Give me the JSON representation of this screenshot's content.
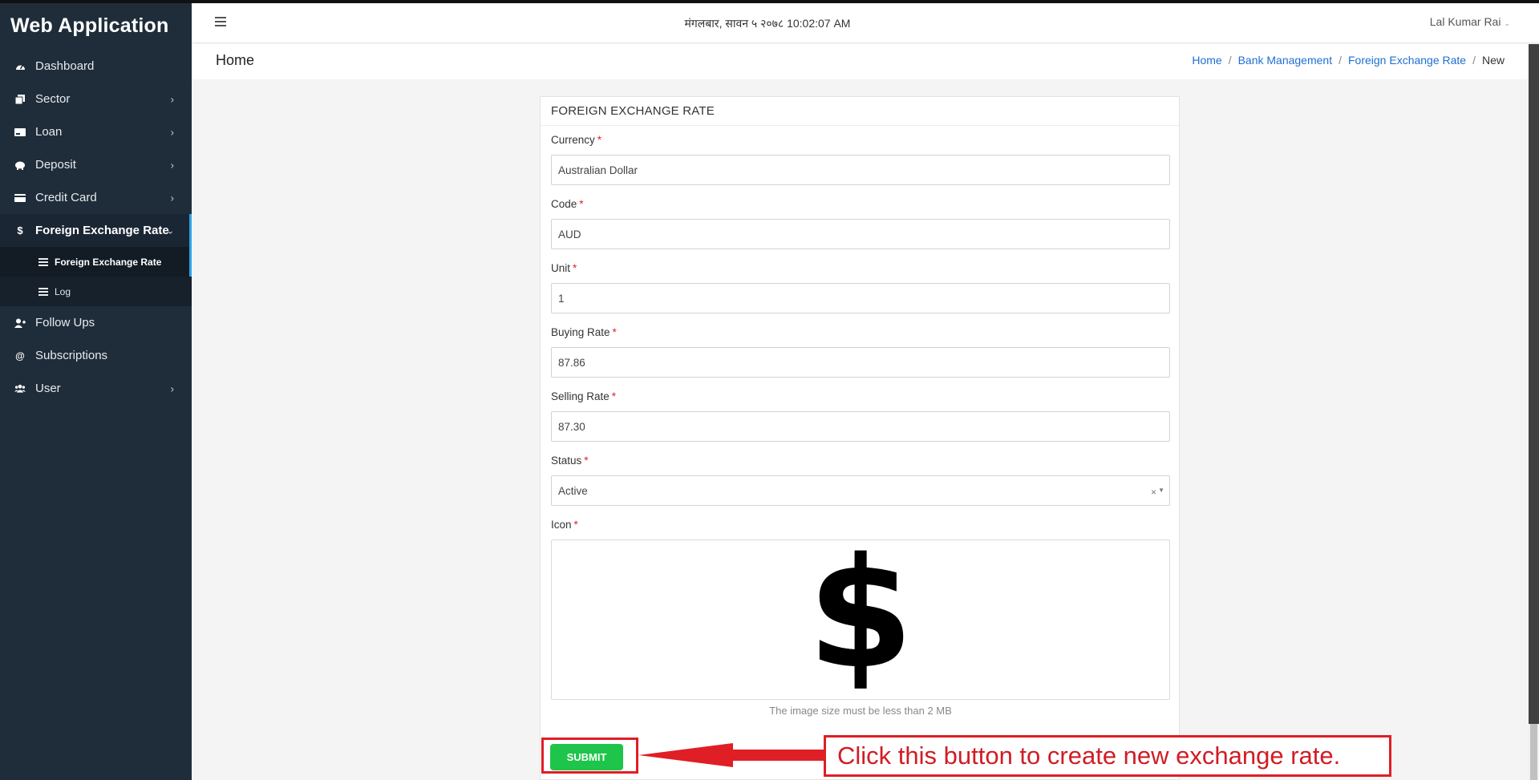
{
  "app": {
    "title": "Web Application"
  },
  "sidebar": {
    "items": [
      {
        "label": "Dashboard",
        "icon": "dashboard-icon"
      },
      {
        "label": "Sector",
        "icon": "sector-icon"
      },
      {
        "label": "Loan",
        "icon": "loan-icon"
      },
      {
        "label": "Deposit",
        "icon": "piggy-bank-icon"
      },
      {
        "label": "Credit Card",
        "icon": "credit-card-icon"
      },
      {
        "label": "Foreign Exchange Rate",
        "icon": "dollar-icon"
      },
      {
        "label": "Follow Ups",
        "icon": "user-plus-icon"
      },
      {
        "label": "Subscriptions",
        "icon": "at-icon"
      },
      {
        "label": "User",
        "icon": "users-icon"
      }
    ],
    "sub_items": [
      {
        "label": "Foreign Exchange Rate"
      },
      {
        "label": "Log"
      }
    ]
  },
  "topbar": {
    "datetime": "मंगलबार, सावन ५ २०७८ 10:02:07 AM",
    "user": "Lal Kumar Rai"
  },
  "page": {
    "title": "Home",
    "breadcrumb": [
      "Home",
      "Bank Management",
      "Foreign Exchange Rate",
      "New"
    ]
  },
  "form": {
    "title": "FOREIGN EXCHANGE RATE",
    "fields": {
      "currency": {
        "label": "Currency",
        "value": "Australian Dollar"
      },
      "code": {
        "label": "Code",
        "value": "AUD"
      },
      "unit": {
        "label": "Unit",
        "value": "1"
      },
      "buying_rate": {
        "label": "Buying Rate",
        "value": "87.86"
      },
      "selling_rate": {
        "label": "Selling Rate",
        "value": "87.30"
      },
      "status": {
        "label": "Status",
        "value": "Active"
      },
      "icon": {
        "label": "Icon",
        "glyph": "$",
        "help": "The image size must be less than 2 MB"
      }
    },
    "required_mark": "*",
    "submit_label": "SUBMIT"
  },
  "annotation": {
    "text": "Click this button to create new exchange rate.",
    "color": "#e01e26"
  },
  "colors": {
    "sidebar_bg": "#1f2d3a",
    "accent": "#2fa4e7",
    "link": "#1f6fd1",
    "submit": "#1ec54a"
  }
}
